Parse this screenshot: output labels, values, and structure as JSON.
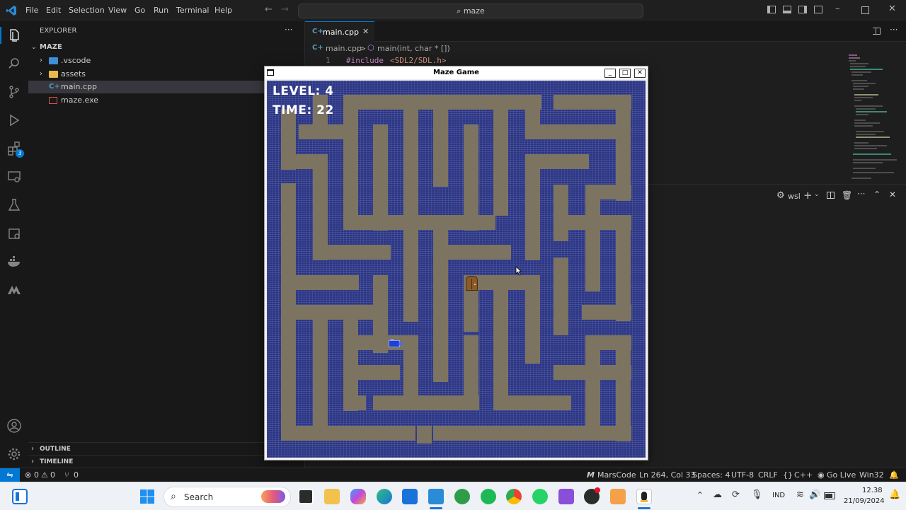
{
  "menu": [
    "File",
    "Edit",
    "Selection",
    "View",
    "Go",
    "Run",
    "Terminal",
    "Help"
  ],
  "search": {
    "label": "maze"
  },
  "activity_badge": "3",
  "sidebar": {
    "title": "EXPLORER",
    "more": "···",
    "folder": "MAZE",
    "items": [
      {
        "label": ".vscode"
      },
      {
        "label": "assets"
      },
      {
        "label": "main.cpp"
      },
      {
        "label": "maze.exe"
      }
    ],
    "outline": "OUTLINE",
    "timeline": "TIMELINE"
  },
  "editor": {
    "tab": "main.cpp",
    "breadcrumb_file": "main.cpp",
    "breadcrumb_sep": ">",
    "breadcrumb_symbol": "main(int, char * [])",
    "line_no": "1",
    "line_directive": "#include",
    "line_header": "<SDL2/SDL.h>"
  },
  "panel": {
    "terminal_name": "wsl"
  },
  "status": {
    "errors": "0",
    "warnings": "0",
    "ports": "0",
    "marscode": "MarsCode",
    "position": "Ln 264, Col 33",
    "spaces": "Spaces: 4",
    "encoding": "UTF-8",
    "eol": "CRLF",
    "language": "C++",
    "golive": "Go Live",
    "platform": "Win32"
  },
  "game": {
    "window_title": "Maze Game",
    "level": "LEVEL: 4",
    "time": "TIME: 22"
  },
  "taskbar": {
    "search": "Search",
    "lang": "IND",
    "time": "12.38",
    "date": "21/09/2024"
  },
  "colors": {
    "accent": "#0078d4",
    "maze_wall": "#2b3585",
    "maze_path": "#7c7461",
    "door": "#8a5a2b",
    "player": "#1e3fd0"
  }
}
